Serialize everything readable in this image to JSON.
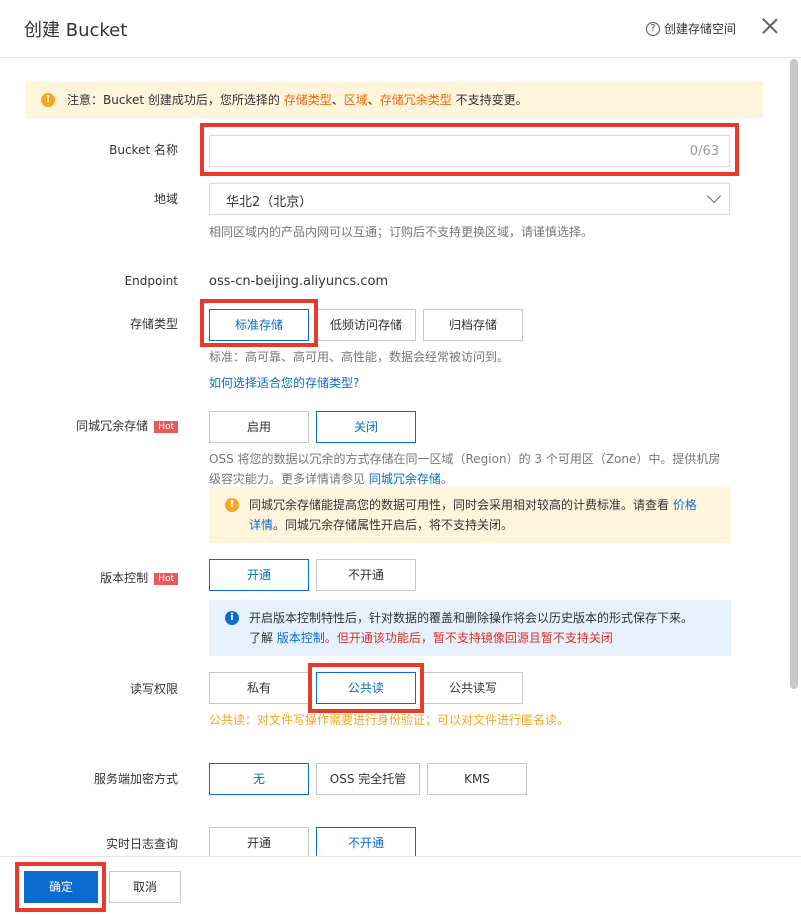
{
  "dialog": {
    "title": "创建 Bucket",
    "help_label": "创建存储空间"
  },
  "notice": {
    "prefix": "注意：Bucket 创建成功后，您所选择的 ",
    "item1": "存储类型",
    "sep1": "、",
    "item2": "区域",
    "sep2": "、",
    "item3": "存储冗余类型",
    "suffix": " 不支持变更。"
  },
  "bucket_name": {
    "label": "Bucket 名称",
    "value": "",
    "counter": "0/63"
  },
  "region": {
    "label": "地域",
    "selected": "华北2（北京）",
    "hint": "相同区域内的产品内网可以互通；订购后不支持更换区域，请谨慎选择。"
  },
  "endpoint": {
    "label": "Endpoint",
    "value": "oss-cn-beijing.aliyuncs.com"
  },
  "storage_class": {
    "label": "存储类型",
    "options": [
      "标准存储",
      "低频访问存储",
      "归档存储"
    ],
    "selected": "标准存储",
    "hint": "标准：高可靠、高可用、高性能，数据会经常被访问到。",
    "link": "如何选择适合您的存储类型?"
  },
  "zone_redundancy": {
    "label": "同城冗余存储",
    "badge": "Hot",
    "options": [
      "启用",
      "关闭"
    ],
    "selected": "关闭",
    "hint_line1": "OSS 将您的数据以冗余的方式存储在同一区域（Region）的 3 个可用区（Zone）中。提供机房",
    "hint_line2_prefix": "级容灾能力。更多详情请参见 ",
    "hint_link": "同城冗余存储",
    "hint_line2_suffix": "。",
    "warning_prefix": "同城冗余存储能提高您的数据可用性，同时会采用相对较高的计费标准。请查看 ",
    "warning_link1": "价格",
    "warning_link2": "详情",
    "warning_suffix": "。同城冗余存储属性开启后，将不支持关闭。"
  },
  "versioning": {
    "label": "版本控制",
    "badge": "Hot",
    "options": [
      "开通",
      "不开通"
    ],
    "selected": "开通",
    "info_line1": "开启版本控制特性后，针对数据的覆盖和删除操作将会以历史版本的形式保存下来。",
    "info_prefix": "了解 ",
    "info_link": "版本控制",
    "info_red": "。但开通该功能后，暂不支持镜像回源且暂不支持关闭"
  },
  "acl": {
    "label": "读写权限",
    "options": [
      "私有",
      "公共读",
      "公共读写"
    ],
    "selected": "公共读",
    "hint": "公共读：对文件写操作需要进行身份验证；可以对文件进行匿名读。"
  },
  "encryption": {
    "label": "服务端加密方式",
    "options": [
      "无",
      "OSS 完全托管",
      "KMS"
    ],
    "selected": "无"
  },
  "realtime_log": {
    "label": "实时日志查询",
    "options": [
      "开通",
      "不开通"
    ],
    "selected": "不开通"
  },
  "footer": {
    "ok": "确定",
    "cancel": "取消"
  }
}
